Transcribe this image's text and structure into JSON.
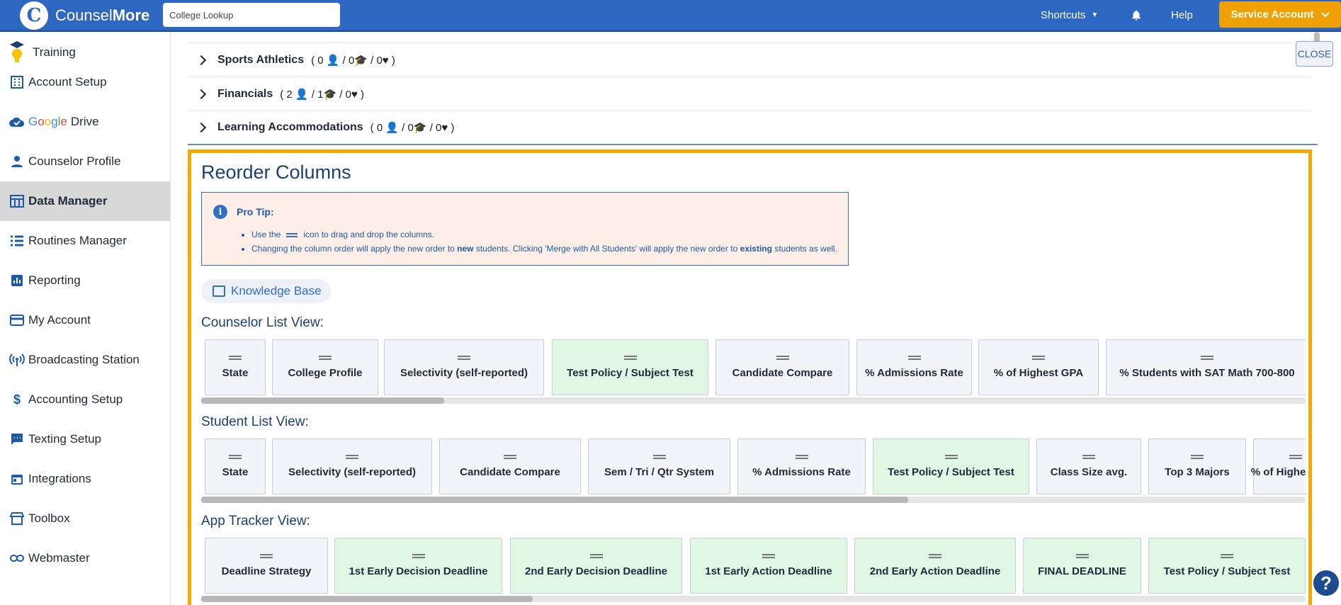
{
  "header": {
    "logo_text_a": "Counsel",
    "logo_text_b": "More",
    "search_value": "College Lookup",
    "shortcuts": "Shortcuts",
    "help": "Help",
    "account": "Service Account"
  },
  "sidebar": {
    "items": [
      {
        "label": "Training",
        "icon": "lightbulb-icon"
      },
      {
        "label": "Account Setup",
        "icon": "building-icon"
      },
      {
        "label_google": "Google",
        "label": "Drive",
        "icon": "cloud-check-icon"
      },
      {
        "label": "Counselor Profile",
        "icon": "person-icon"
      },
      {
        "label": "Data Manager",
        "icon": "table-icon"
      },
      {
        "label": "Routines Manager",
        "icon": "list-icon"
      },
      {
        "label": "Reporting",
        "icon": "bar-chart-icon"
      },
      {
        "label": "My Account",
        "icon": "credit-card-icon"
      },
      {
        "label": "Broadcasting Station",
        "icon": "broadcast-icon"
      },
      {
        "label": "Accounting Setup",
        "icon": "dollar-icon"
      },
      {
        "label": "Texting Setup",
        "icon": "chat-icon"
      },
      {
        "label": "Integrations",
        "icon": "calendar-icon"
      },
      {
        "label": "Toolbox",
        "icon": "store-icon"
      },
      {
        "label": "Webmaster",
        "icon": "link-icon"
      }
    ]
  },
  "accordion": [
    {
      "name": "Sports Athletics",
      "meta": "( 0 👤 / 0🎓 / 0♥ )"
    },
    {
      "name": "Financials",
      "meta": "( 2 👤 / 1🎓 / 0♥ )"
    },
    {
      "name": "Learning Accommodations",
      "meta": "( 0 👤 / 0🎓 / 0♥ )"
    }
  ],
  "panel": {
    "title": "Reorder Columns",
    "tip_title": "Pro Tip:",
    "tip_1a": "Use the",
    "tip_1b": "icon to drag and drop the columns.",
    "tip_2a": "Changing the column order will apply the new order to ",
    "tip_2b": "new",
    "tip_2c": " students. Clicking 'Merge with All Students' will apply the new order to ",
    "tip_2d": "existing",
    "tip_2e": " students as well.",
    "kb": "Knowledge Base",
    "close": "CLOSE"
  },
  "views": {
    "counselor": {
      "label": "Counselor List View:",
      "cards": [
        {
          "text": "State",
          "green": false
        },
        {
          "text": "College Profile",
          "green": false
        },
        {
          "text": "Selectivity (self-reported)",
          "green": false
        },
        {
          "text": "Test Policy / Subject Test",
          "green": true
        },
        {
          "text": "Candidate Compare",
          "green": false
        },
        {
          "text": "% Admissions Rate",
          "green": false
        },
        {
          "text": "% of Highest GPA",
          "green": false
        },
        {
          "text": "% Students with SAT Math 700-800",
          "green": false
        }
      ],
      "scroll": 0.22
    },
    "student": {
      "label": "Student List View:",
      "cards": [
        {
          "text": "State",
          "green": false
        },
        {
          "text": "Selectivity (self-reported)",
          "green": false
        },
        {
          "text": "Candidate Compare",
          "green": false
        },
        {
          "text": "Sem / Tri / Qtr System",
          "green": false
        },
        {
          "text": "% Admissions Rate",
          "green": false
        },
        {
          "text": "Test Policy / Subject Test",
          "green": true
        },
        {
          "text": "Class Size avg.",
          "green": false
        },
        {
          "text": "Top 3 Majors",
          "green": false
        },
        {
          "text": "% of Highest GPA",
          "green": false
        }
      ],
      "scroll": 0.64
    },
    "tracker": {
      "label": "App Tracker View:",
      "cards": [
        {
          "text": "Deadline Strategy",
          "green": false
        },
        {
          "text": "1st Early Decision Deadline",
          "green": true
        },
        {
          "text": "2nd Early Decision Deadline",
          "green": true
        },
        {
          "text": "1st Early Action Deadline",
          "green": true
        },
        {
          "text": "2nd Early Action Deadline",
          "green": true
        },
        {
          "text": "FINAL DEADLINE",
          "green": true
        },
        {
          "text": "Test Policy / Subject Test",
          "green": true
        }
      ],
      "scroll": 0.3
    }
  }
}
